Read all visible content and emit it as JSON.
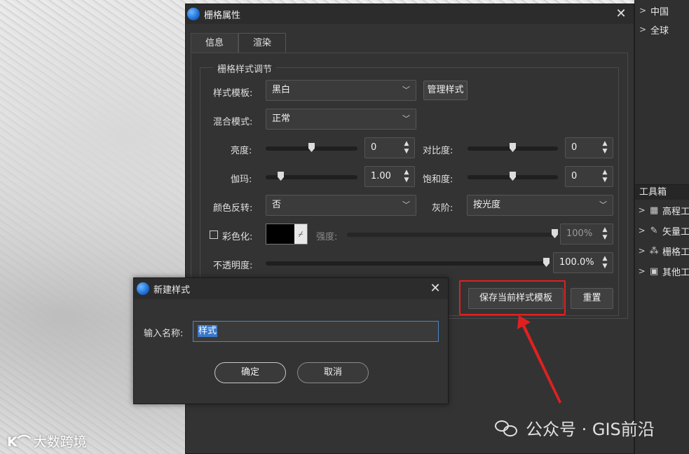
{
  "map": {
    "watermark": "大数跨境",
    "watermark_icon": "K⌒"
  },
  "right_panel": {
    "tree": [
      {
        "label": "中国"
      },
      {
        "label": "全球"
      }
    ],
    "toolbox_title": "工具箱",
    "toolbox_items": [
      {
        "label": "高程工",
        "icon": "grid-icon"
      },
      {
        "label": "矢量工",
        "icon": "pen-icon"
      },
      {
        "label": "栅格工",
        "icon": "cluster-icon"
      },
      {
        "label": "其他工",
        "icon": "apps-icon"
      }
    ]
  },
  "raster_dialog": {
    "title": "栅格属性",
    "tabs": [
      {
        "label": "信息"
      },
      {
        "label": "渲染"
      }
    ],
    "active_tab": 1,
    "group_title": "栅格样式调节",
    "style_template": {
      "label": "样式模板:",
      "value": "黑白",
      "manage_label": "管理样式"
    },
    "blend_mode": {
      "label": "混合模式:",
      "value": "正常"
    },
    "brightness": {
      "label": "亮度:",
      "value": "0",
      "level": 0.5
    },
    "contrast": {
      "label": "对比度:",
      "value": "0",
      "level": 0.5
    },
    "gamma": {
      "label": "伽玛:",
      "value": "1.00",
      "level": 0.14
    },
    "saturation": {
      "label": "饱和度:",
      "value": "0",
      "level": 0.5
    },
    "invert": {
      "label": "颜色反转:",
      "value": "否"
    },
    "grayscale": {
      "label": "灰阶:",
      "value": "按光度"
    },
    "colorize": {
      "label": "彩色化:",
      "checked": false,
      "color": "#000000",
      "strength_label": "强度:",
      "strength_value": "100%",
      "strength_level": 1.0
    },
    "opacity": {
      "label": "不透明度:",
      "value": "100.0%",
      "level": 1.0
    },
    "save_template_label": "保存当前样式模板",
    "reset_label": "重置"
  },
  "new_style_dialog": {
    "title": "新建样式",
    "name_label": "输入名称:",
    "name_value": "样式",
    "ok_label": "确定",
    "cancel_label": "取消"
  },
  "footer_watermark": {
    "text": "公众号 · GIS前沿"
  },
  "colors": {
    "highlight": "#e02020",
    "accent": "#3a78c8"
  }
}
